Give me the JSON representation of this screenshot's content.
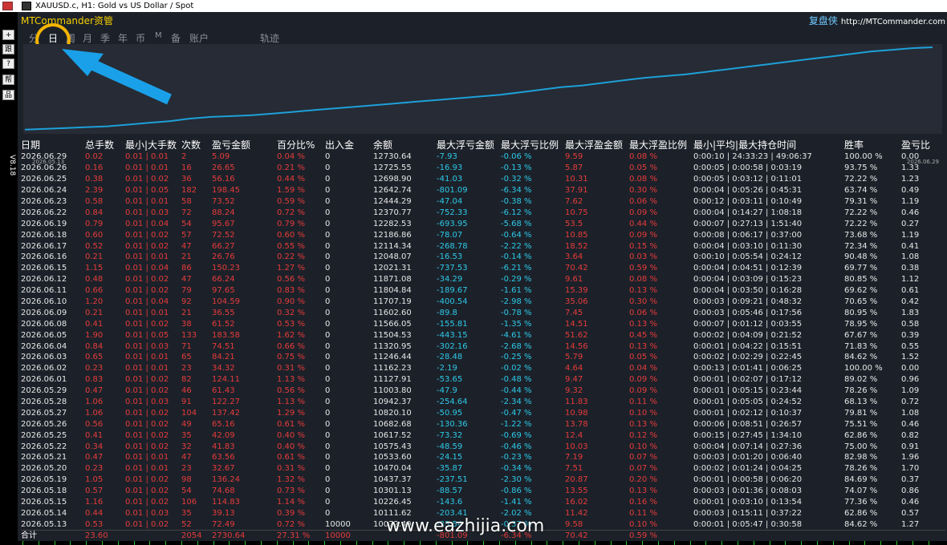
{
  "window": {
    "title": "XAUUSD.c, H1:  Gold vs US Dollar / Spot"
  },
  "side": {
    "buttons": [
      "+",
      "跟",
      "?",
      "帮",
      "品"
    ],
    "version": "V8.18"
  },
  "app": {
    "brand": "MTCommander资管",
    "brand_cn": "复盘侠",
    "brand_url": "http://MTCommander.com"
  },
  "tabs": [
    {
      "label": "分"
    },
    {
      "label": "日"
    },
    {
      "label": "周"
    },
    {
      "label": "月"
    },
    {
      "label": "季"
    },
    {
      "label": "年"
    },
    {
      "label": "币"
    },
    {
      "label": "M"
    },
    {
      "label": "备"
    },
    {
      "label": "账户"
    },
    {
      "label": "轨迹"
    }
  ],
  "chart_data": {
    "type": "line",
    "x_start": "2026.05.13",
    "x_end": "2026.06.29",
    "color": "#1ea0d8",
    "values": [
      0.03,
      0.04,
      0.05,
      0.06,
      0.07,
      0.09,
      0.11,
      0.13,
      0.16,
      0.18,
      0.19,
      0.2,
      0.22,
      0.24,
      0.26,
      0.28,
      0.3,
      0.32,
      0.34,
      0.36,
      0.38,
      0.4,
      0.42,
      0.44,
      0.47,
      0.5,
      0.53,
      0.55,
      0.58,
      0.61,
      0.64,
      0.66,
      0.68,
      0.71,
      0.74,
      0.77,
      0.8,
      0.83,
      0.86,
      0.89,
      0.92,
      0.95,
      0.97,
      0.99,
      1.0
    ]
  },
  "table": {
    "headers": [
      "日期",
      "总手数",
      "最小|大手数",
      "次数",
      "盈亏金额",
      "百分比%",
      "出入金",
      "余额",
      "最大浮亏金额",
      "最大浮亏比例",
      "最大浮盈金额",
      "最大浮盈比例",
      "最小|平均|最大持仓时间",
      "",
      "胜率",
      "盈亏比"
    ],
    "rows": [
      [
        "2026.06.29",
        "0.02",
        "0.01 | 0.01",
        "2",
        "5.09",
        "0.04 %",
        "0",
        "12730.64",
        "-7.93",
        "-0.06 %",
        "9.59",
        "0.08 %",
        "0:00:10 | 24:33:23 | 49:06:37",
        "",
        "100.00 %",
        "0.00"
      ],
      [
        "2026.06.26",
        "0.16",
        "0.01 | 0.01",
        "16",
        "26.65",
        "0.21 %",
        "0",
        "12725.55",
        "-16.93",
        "-0.13 %",
        "5.87",
        "0.05 %",
        "0:00:05 | 0:00:58 | 0:03:19",
        "",
        "93.75 %",
        "1.33"
      ],
      [
        "2026.06.25",
        "0.38",
        "0.01 | 0.02",
        "36",
        "56.16",
        "0.44 %",
        "0",
        "12698.90",
        "-41.03",
        "-0.32 %",
        "10.31",
        "0.08 %",
        "0:00:05 | 0:03:12 | 0:11:01",
        "",
        "72.22 %",
        "1.23"
      ],
      [
        "2026.06.24",
        "2.39",
        "0.01 | 0.05",
        "182",
        "198.45",
        "1.59 %",
        "0",
        "12642.74",
        "-801.09",
        "-6.34 %",
        "37.91",
        "0.30 %",
        "0:00:04 | 0:05:26 | 0:45:31",
        "",
        "63.74 %",
        "0.49"
      ],
      [
        "2026.06.23",
        "0.58",
        "0.01 | 0.01",
        "58",
        "73.52",
        "0.59 %",
        "0",
        "12444.29",
        "-47.04",
        "-0.38 %",
        "7.62",
        "0.06 %",
        "0:00:12 | 0:03:11 | 0:10:49",
        "",
        "79.31 %",
        "1.19"
      ],
      [
        "2026.06.22",
        "0.84",
        "0.01 | 0.03",
        "72",
        "88.24",
        "0.72 %",
        "0",
        "12370.77",
        "-752.33",
        "-6.12 %",
        "10.75",
        "0.09 %",
        "0:00:04 | 0:14:27 | 1:08:18",
        "",
        "72.22 %",
        "0.46"
      ],
      [
        "2026.06.19",
        "0.79",
        "0.01 | 0.04",
        "54",
        "95.67",
        "0.79 %",
        "0",
        "12282.53",
        "-693.95",
        "-5.68 %",
        "53.5",
        "0.44 %",
        "0:00:07 | 0:27:13 | 1:51:40",
        "",
        "72.22 %",
        "0.27"
      ],
      [
        "2026.06.18",
        "0.60",
        "0.01 | 0.02",
        "57",
        "72.52",
        "0.60 %",
        "0",
        "12186.86",
        "-78.07",
        "-0.64 %",
        "10.85",
        "0.09 %",
        "0:00:08 | 0:06:17 | 0:37:00",
        "",
        "73.68 %",
        "1.19"
      ],
      [
        "2026.06.17",
        "0.52",
        "0.01 | 0.02",
        "47",
        "66.27",
        "0.55 %",
        "0",
        "12114.34",
        "-268.78",
        "-2.22 %",
        "18.52",
        "0.15 %",
        "0:00:04 | 0:03:10 | 0:11:30",
        "",
        "72.34 %",
        "0.41"
      ],
      [
        "2026.06.16",
        "0.21",
        "0.01 | 0.01",
        "21",
        "26.76",
        "0.22 %",
        "0",
        "12048.07",
        "-16.53",
        "-0.14 %",
        "3.64",
        "0.03 %",
        "0:00:10 | 0:05:54 | 0:24:12",
        "",
        "90.48 %",
        "1.08"
      ],
      [
        "2026.06.15",
        "1.15",
        "0.01 | 0.04",
        "86",
        "150.23",
        "1.27 %",
        "0",
        "12021.31",
        "-737.53",
        "-6.21 %",
        "70.42",
        "0.59 %",
        "0:00:04 | 0:04:51 | 0:12:39",
        "",
        "69.77 %",
        "0.38"
      ],
      [
        "2026.06.12",
        "0.48",
        "0.01 | 0.02",
        "47",
        "66.24",
        "0.56 %",
        "0",
        "11871.08",
        "-34.29",
        "-0.29 %",
        "9.61",
        "0.08 %",
        "0:00:04 | 0:03:09 | 0:15:23",
        "",
        "80.85 %",
        "1.12"
      ],
      [
        "2026.06.11",
        "0.66",
        "0.01 | 0.02",
        "79",
        "97.65",
        "0.83 %",
        "0",
        "11804.84",
        "-189.67",
        "-1.61 %",
        "15.39",
        "0.13 %",
        "0:00:04 | 0:03:50 | 0:16:28",
        "",
        "69.62 %",
        "0.61"
      ],
      [
        "2026.06.10",
        "1.20",
        "0.01 | 0.04",
        "92",
        "104.59",
        "0.90 %",
        "0",
        "11707.19",
        "-400.54",
        "-2.98 %",
        "35.06",
        "0.30 %",
        "0:00:03 | 0:09:21 | 0:48:32",
        "",
        "70.65 %",
        "0.42"
      ],
      [
        "2026.06.09",
        "0.21",
        "0.01 | 0.01",
        "21",
        "36.55",
        "0.32 %",
        "0",
        "11602.60",
        "-89.8",
        "-0.78 %",
        "7.45",
        "0.06 %",
        "0:00:03 | 0:05:46 | 0:17:56",
        "",
        "80.95 %",
        "1.83"
      ],
      [
        "2026.06.08",
        "0.41",
        "0.01 | 0.02",
        "38",
        "61.52",
        "0.53 %",
        "0",
        "11566.05",
        "-155.81",
        "-1.35 %",
        "14.51",
        "0.13 %",
        "0:00:07 | 0:01:12 | 0:03:55",
        "",
        "78.95 %",
        "0.58"
      ],
      [
        "2026.06.05",
        "1.90",
        "0.01 | 0.05",
        "133",
        "183.58",
        "1.62 %",
        "0",
        "11504.53",
        "-443.15",
        "-4.61 %",
        "51.62",
        "0.45 %",
        "0:00:02 | 0:04:09 | 0:21:52",
        "",
        "67.67 %",
        "0.39"
      ],
      [
        "2026.06.04",
        "0.84",
        "0.01 | 0.03",
        "71",
        "74.51",
        "0.66 %",
        "0",
        "11320.95",
        "-302.16",
        "-2.68 %",
        "14.56",
        "0.13 %",
        "0:00:01 | 0:04:22 | 0:15:51",
        "",
        "71.83 %",
        "0.55"
      ],
      [
        "2026.06.03",
        "0.65",
        "0.01 | 0.01",
        "65",
        "84.21",
        "0.75 %",
        "0",
        "11246.44",
        "-28.48",
        "-0.25 %",
        "5.79",
        "0.05 %",
        "0:00:02 | 0:02:29 | 0:22:45",
        "",
        "84.62 %",
        "1.52"
      ],
      [
        "2026.06.02",
        "0.23",
        "0.01 | 0.01",
        "23",
        "34.32",
        "0.31 %",
        "0",
        "11162.23",
        "-2.19",
        "-0.02 %",
        "4.64",
        "0.04 %",
        "0:00:13 | 0:01:41 | 0:06:25",
        "",
        "100.00 %",
        "0.00"
      ],
      [
        "2026.06.01",
        "0.83",
        "0.01 | 0.02",
        "82",
        "124.11",
        "1.13 %",
        "0",
        "11127.91",
        "-53.65",
        "-0.48 %",
        "9.47",
        "0.09 %",
        "0:00:01 | 0:02:07 | 0:17:12",
        "",
        "89.02 %",
        "0.96"
      ],
      [
        "2026.05.29",
        "0.47",
        "0.01 | 0.02",
        "46",
        "61.43",
        "0.56 %",
        "0",
        "11003.80",
        "-47.9",
        "-0.44 %",
        "9.32",
        "0.09 %",
        "0:00:01 | 0:05:15 | 0:23:44",
        "",
        "78.26 %",
        "1.09"
      ],
      [
        "2026.05.28",
        "1.06",
        "0.01 | 0.03",
        "91",
        "122.27",
        "1.13 %",
        "0",
        "10942.37",
        "-254.64",
        "-2.34 %",
        "11.83",
        "0.11 %",
        "0:00:01 | 0:05:05 | 0:24:52",
        "",
        "68.13 %",
        "0.72"
      ],
      [
        "2026.05.27",
        "1.06",
        "0.01 | 0.02",
        "104",
        "137.42",
        "1.29 %",
        "0",
        "10820.10",
        "-50.95",
        "-0.47 %",
        "10.98",
        "0.10 %",
        "0:00:01 | 0:02:12 | 0:10:37",
        "",
        "79.81 %",
        "1.08"
      ],
      [
        "2026.05.26",
        "0.56",
        "0.01 | 0.02",
        "49",
        "65.16",
        "0.61 %",
        "0",
        "10682.68",
        "-130.36",
        "-1.22 %",
        "13.78",
        "0.13 %",
        "0:00:06 | 0:08:51 | 0:26:57",
        "",
        "75.51 %",
        "0.46"
      ],
      [
        "2026.05.25",
        "0.41",
        "0.01 | 0.02",
        "35",
        "42.09",
        "0.40 %",
        "0",
        "10617.52",
        "-73.32",
        "-0.69 %",
        "12.4",
        "0.12 %",
        "0:00:15 | 0:27:45 | 1:34:10",
        "",
        "62.86 %",
        "0.82"
      ],
      [
        "2026.05.22",
        "0.34",
        "0.01 | 0.02",
        "32",
        "41.83",
        "0.40 %",
        "0",
        "10575.43",
        "-48.59",
        "-0.46 %",
        "10.03",
        "0.10 %",
        "0:00:04 | 0:07:14 | 0:27:36",
        "",
        "75.00 %",
        "0.91"
      ],
      [
        "2026.05.21",
        "0.47",
        "0.01 | 0.01",
        "47",
        "63.56",
        "0.61 %",
        "0",
        "10533.60",
        "-24.15",
        "-0.23 %",
        "7.19",
        "0.07 %",
        "0:00:03 | 0:01:20 | 0:06:40",
        "",
        "82.98 %",
        "1.96"
      ],
      [
        "2026.05.20",
        "0.23",
        "0.01 | 0.01",
        "23",
        "32.67",
        "0.31 %",
        "0",
        "10470.04",
        "-35.87",
        "-0.34 %",
        "7.51",
        "0.07 %",
        "0:00:02 | 0:01:24 | 0:04:25",
        "",
        "78.26 %",
        "1.70"
      ],
      [
        "2026.05.19",
        "1.05",
        "0.01 | 0.02",
        "98",
        "136.24",
        "1.32 %",
        "0",
        "10437.37",
        "-237.51",
        "-2.30 %",
        "20.87",
        "0.20 %",
        "0:00:01 | 0:00:58 | 0:06:20",
        "",
        "84.69 %",
        "0.37"
      ],
      [
        "2026.05.18",
        "0.57",
        "0.01 | 0.02",
        "54",
        "74.68",
        "0.73 %",
        "0",
        "10301.13",
        "-88.57",
        "-0.86 %",
        "13.55",
        "0.13 %",
        "0:00:03 | 0:01:36 | 0:08:03",
        "",
        "74.07 %",
        "0.86"
      ],
      [
        "2026.05.15",
        "1.16",
        "0.01 | 0.02",
        "106",
        "114.83",
        "1.14 %",
        "0",
        "10226.45",
        "-143.6",
        "-1.41 %",
        "16.02",
        "0.16 %",
        "0:00:01 | 0:03:10 | 0:13:54",
        "",
        "77.36 %",
        "0.46"
      ],
      [
        "2026.05.14",
        "0.44",
        "0.01 | 0.03",
        "35",
        "39.13",
        "0.39 %",
        "0",
        "10111.62",
        "-203.41",
        "-2.02 %",
        "11.42",
        "0.11 %",
        "0:00:03 | 0:15:11 | 0:37:22",
        "",
        "62.86 %",
        "0.57"
      ],
      [
        "2026.05.13",
        "0.53",
        "0.01 | 0.02",
        "52",
        "72.49",
        "0.72 %",
        "10000",
        "10072.49",
        "-35.54",
        "-0.37 %",
        "9.58",
        "0.10 %",
        "0:00:01 | 0:05:47 | 0:30:58",
        "",
        "84.62 %",
        "1.27"
      ]
    ],
    "total": [
      "合计",
      "23.60",
      "",
      "2054",
      "2730.64",
      "27.31 %",
      "10000",
      "",
      "-801.09",
      "-6.34 %",
      "70.42",
      "0.59 %",
      "",
      "",
      "",
      ""
    ]
  },
  "watermark": "www.eazhijia.com"
}
